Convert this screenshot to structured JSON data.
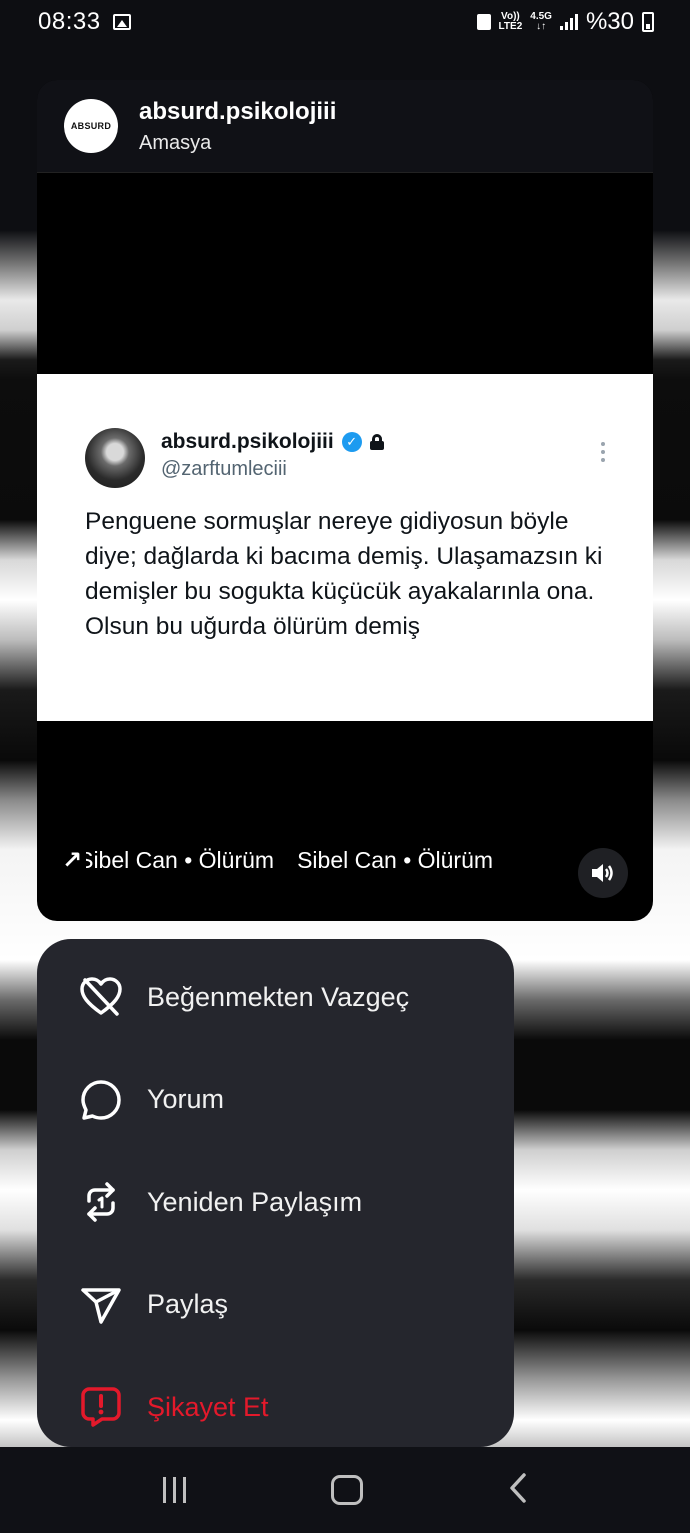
{
  "status_bar": {
    "time": "08:33",
    "network_top": "Vo))",
    "network_bottom": "LTE2",
    "data_top": "4.5G",
    "data_bottom": "↓↑",
    "battery": "%30"
  },
  "post": {
    "username": "absurd.psikolojiii",
    "location": "Amasya",
    "avatar_text": "ABSURD",
    "tweet": {
      "name": "absurd.psikolojiii",
      "handle": "@zarftumleciii",
      "text": "Penguene sormuşlar nereye gidiyosun böyle diye; dağlarda ki bacıma demiş. Ulaşamazsın ki demişler bu sogukta küçücük ayakalarınla ona. Olsun bu uğurda ölürüm demiş"
    },
    "music": {
      "first": "Sibel Can • Ölürüm",
      "second": "Sibel Can • Ölürüm"
    }
  },
  "menu": {
    "unlike": "Beğenmekten Vazgeç",
    "comment": "Yorum",
    "repost": "Yeniden Paylaşım",
    "share": "Paylaş",
    "report": "Şikayet Et"
  },
  "colors": {
    "danger": "#e4192b",
    "verified": "#1d9bf0",
    "menu_bg": "#25262d"
  }
}
